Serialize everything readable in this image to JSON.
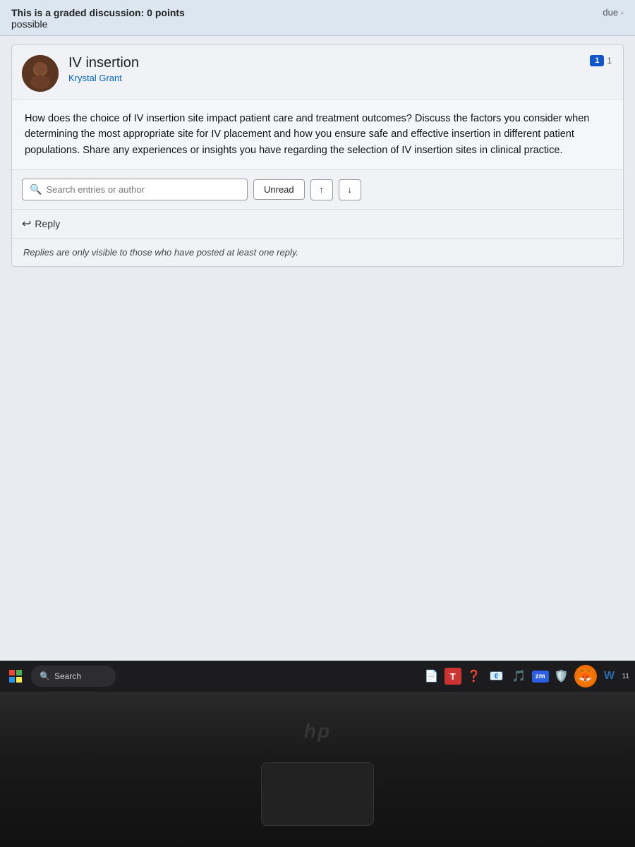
{
  "header": {
    "graded_label": "This is a graded discussion: 0 points",
    "possible_label": "possible",
    "due_label": "due -"
  },
  "post": {
    "title": "IV insertion",
    "author": "Krystal Grant",
    "badge_count": "1",
    "badge_suffix": "1",
    "body_text": "How does the choice of IV insertion site impact patient care and treatment outcomes? Discuss the factors you consider when determining the most appropriate site for IV placement and how you ensure safe and effective insertion in different patient populations. Share any experiences or insights you have regarding the selection of IV insertion sites in clinical practice."
  },
  "toolbar": {
    "search_placeholder": "Search entries or author",
    "unread_label": "Unread",
    "upload_icon": "↑",
    "download_icon": "↓"
  },
  "reply": {
    "label": "Reply"
  },
  "notice": {
    "text": "Replies are only visible to those who have posted at least one reply."
  },
  "taskbar": {
    "search_label": "Search",
    "zm_label": "zm",
    "time": "11"
  }
}
